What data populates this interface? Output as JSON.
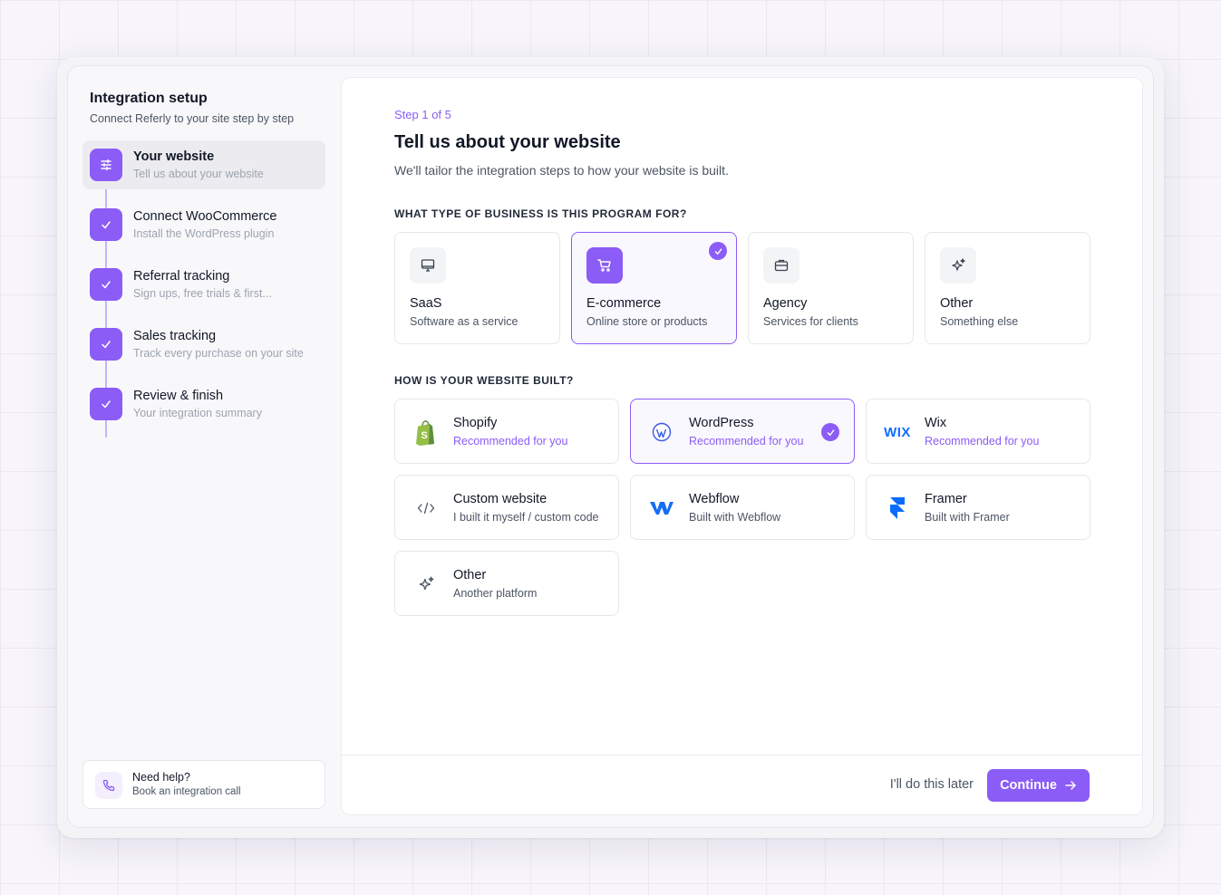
{
  "sidebar": {
    "title": "Integration setup",
    "subtitle": "Connect Referly to your site step by step",
    "steps": [
      {
        "title": "Your website",
        "desc": "Tell us about your website",
        "state": "active",
        "icon": "sliders-icon"
      },
      {
        "title": "Connect WooCommerce",
        "desc": "Install the WordPress plugin",
        "state": "done",
        "icon": "check-icon"
      },
      {
        "title": "Referral tracking",
        "desc": "Sign ups, free trials & first...",
        "state": "done",
        "icon": "check-icon"
      },
      {
        "title": "Sales tracking",
        "desc": "Track every purchase on your site",
        "state": "done",
        "icon": "check-icon"
      },
      {
        "title": "Review & finish",
        "desc": "Your integration summary",
        "state": "done",
        "icon": "check-icon"
      }
    ],
    "help": {
      "title": "Need help?",
      "subtitle": "Book an integration call",
      "icon": "phone-icon"
    }
  },
  "main": {
    "step_label": "Step 1 of 5",
    "title": "Tell us about your website",
    "subtitle": "We'll tailor the integration steps to how your website is built.",
    "business_label": "WHAT TYPE OF BUSINESS IS THIS PROGRAM FOR?",
    "business_types": [
      {
        "title": "SaaS",
        "desc": "Software as a service",
        "icon": "monitor-icon",
        "selected": false
      },
      {
        "title": "E-commerce",
        "desc": "Online store or products",
        "icon": "cart-icon",
        "selected": true
      },
      {
        "title": "Agency",
        "desc": "Services for clients",
        "icon": "briefcase-icon",
        "selected": false
      },
      {
        "title": "Other",
        "desc": "Something else",
        "icon": "sparkles-icon",
        "selected": false
      }
    ],
    "platform_label": "HOW IS YOUR WEBSITE BUILT?",
    "platforms": [
      {
        "title": "Shopify",
        "desc": "Recommended for you",
        "recommended": true,
        "selected": false,
        "icon": "shopify-icon"
      },
      {
        "title": "WordPress",
        "desc": "Recommended for you",
        "recommended": true,
        "selected": true,
        "icon": "wordpress-icon"
      },
      {
        "title": "Wix",
        "desc": "Recommended for you",
        "recommended": true,
        "selected": false,
        "icon": "wix-icon",
        "logo_text": "WIX"
      },
      {
        "title": "Custom website",
        "desc": "I built it myself / custom code",
        "recommended": false,
        "selected": false,
        "icon": "code-icon"
      },
      {
        "title": "Webflow",
        "desc": "Built with Webflow",
        "recommended": false,
        "selected": false,
        "icon": "webflow-icon"
      },
      {
        "title": "Framer",
        "desc": "Built with Framer",
        "recommended": false,
        "selected": false,
        "icon": "framer-icon"
      },
      {
        "title": "Other",
        "desc": "Another platform",
        "recommended": false,
        "selected": false,
        "icon": "sparkles-icon"
      }
    ],
    "footer": {
      "later_label": "I'll do this later",
      "continue_label": "Continue"
    }
  },
  "colors": {
    "accent": "#8b5cf6",
    "accent_light": "#c4b5fd",
    "shopify": "#5e8e3e",
    "wix": "#116dff",
    "webflow": "#146ef5",
    "framer": "#0a6cff",
    "wordpress": "#3858e9"
  }
}
